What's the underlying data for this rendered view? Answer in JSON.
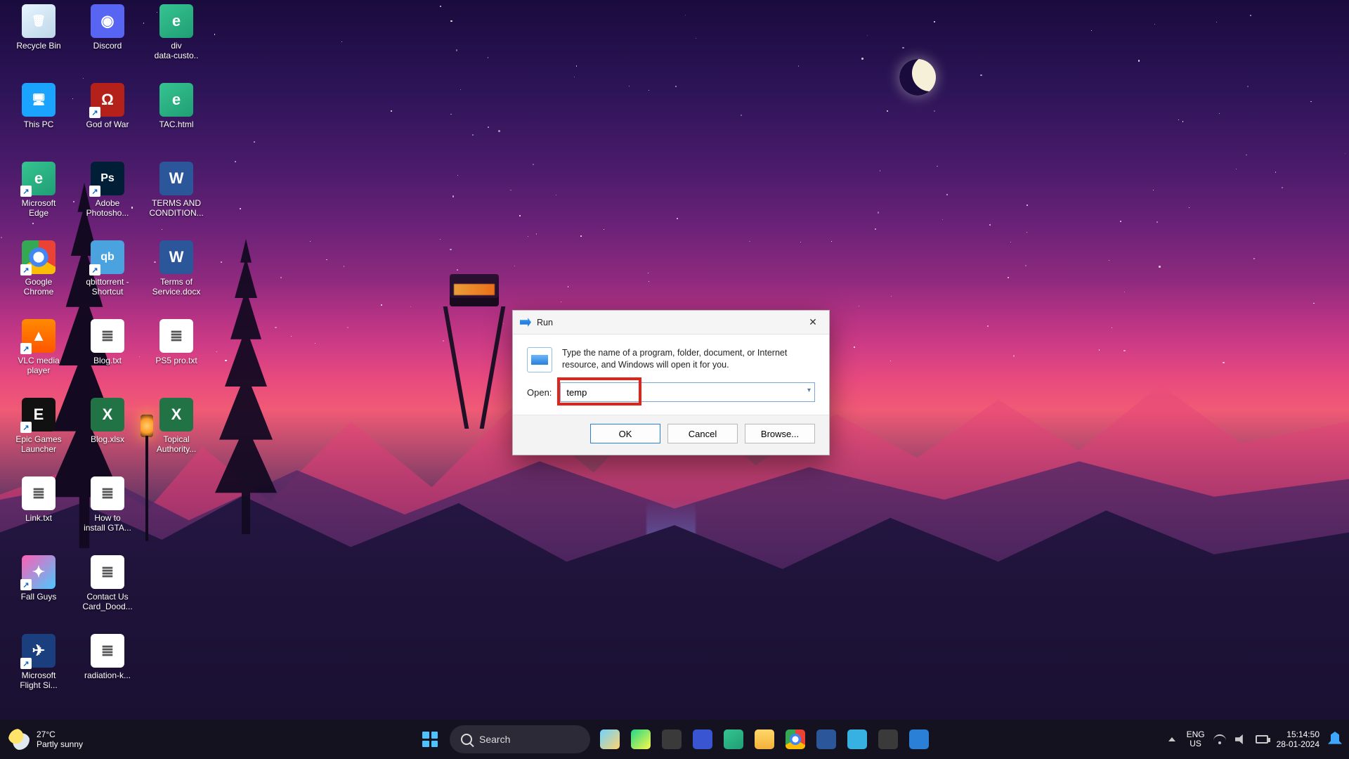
{
  "desktop_icons": [
    {
      "label": "Recycle Bin",
      "bg": "linear-gradient(145deg,#e7f4ff,#bcd7e8)",
      "glyph": "🗑"
    },
    {
      "label": "Discord",
      "bg": "#5865F2",
      "glyph": "◉"
    },
    {
      "label": "div\ndata-custo..",
      "bg": "linear-gradient(145deg,#36c491,#1f9e74)",
      "glyph": "e"
    },
    {
      "label": "This PC",
      "bg": "#1aa3ff",
      "glyph": "🖥"
    },
    {
      "label": "God of War",
      "bg": "#b3211a",
      "glyph": "Ω",
      "shortcut": true
    },
    {
      "label": "TAC.html",
      "bg": "linear-gradient(145deg,#36c491,#1f9e74)",
      "glyph": "e"
    },
    {
      "label": "Microsoft\nEdge",
      "bg": "linear-gradient(145deg,#36c491,#1f9e74)",
      "glyph": "e",
      "shortcut": true
    },
    {
      "label": "Adobe\nPhotosho...",
      "bg": "#001e36",
      "glyph": "Ps",
      "shortcut": true
    },
    {
      "label": "TERMS AND\nCONDITION...",
      "bg": "#2b579a",
      "glyph": "W"
    },
    {
      "label": "Google\nChrome",
      "bg": "radial-gradient(circle,#fff 0 22%,#4285f4 23% 40%,transparent 41%),conic-gradient(#ea4335 0 120deg,#fbbc05 120deg 240deg,#34a853 240deg 360deg)",
      "glyph": "",
      "shortcut": true
    },
    {
      "label": "qbittorrent -\nShortcut",
      "bg": "#4aa3df",
      "glyph": "qb",
      "shortcut": true
    },
    {
      "label": "Terms of\nService.docx",
      "bg": "#2b579a",
      "glyph": "W"
    },
    {
      "label": "VLC media\nplayer",
      "bg": "linear-gradient(180deg,#ff8a00,#ff5500)",
      "glyph": "▲",
      "shortcut": true
    },
    {
      "label": "Blog.txt",
      "bg": "#fff",
      "glyph": "≣",
      "fg": "#555"
    },
    {
      "label": "PS5 pro.txt",
      "bg": "#fff",
      "glyph": "≣",
      "fg": "#555"
    },
    {
      "label": "Epic Games\nLauncher",
      "bg": "#111",
      "glyph": "E",
      "shortcut": true
    },
    {
      "label": "Blog.xlsx",
      "bg": "#217346",
      "glyph": "X"
    },
    {
      "label": "Topical\nAuthority...",
      "bg": "#217346",
      "glyph": "X"
    },
    {
      "label": "Link.txt",
      "bg": "#fff",
      "glyph": "≣",
      "fg": "#555"
    },
    {
      "label": "How to\ninstall GTA...",
      "bg": "#fff",
      "glyph": "≣",
      "fg": "#555"
    },
    {
      "label": "Fall Guys",
      "bg": "linear-gradient(135deg,#ff5fb4,#4ac8ff)",
      "glyph": "✦",
      "shortcut": true
    },
    {
      "label": "Contact Us\nCard_Dood...",
      "bg": "#fff",
      "glyph": "≣",
      "fg": "#555"
    },
    {
      "label": "Microsoft\nFlight Si...",
      "bg": "#1b3e7e",
      "glyph": "✈",
      "shortcut": true
    },
    {
      "label": "radiation-k...",
      "bg": "#fff",
      "glyph": "≣",
      "fg": "#555"
    }
  ],
  "desktop_columns": [
    [
      0,
      3,
      6,
      9,
      12,
      15,
      18,
      20,
      22
    ],
    [
      1,
      4,
      7,
      10,
      13,
      16,
      19,
      21,
      23
    ],
    [
      2,
      5,
      8,
      11,
      14,
      17
    ]
  ],
  "run": {
    "title": "Run",
    "description": "Type the name of a program, folder, document, or Internet resource, and Windows will open it for you.",
    "open_label": "Open:",
    "value": "temp",
    "ok": "OK",
    "cancel": "Cancel",
    "browse": "Browse..."
  },
  "taskbar": {
    "weather_temp": "27°C",
    "weather_cond": "Partly sunny",
    "search_placeholder": "Search",
    "apps": [
      {
        "name": "widgets",
        "bg": "linear-gradient(135deg,#6fd3ff,#ffd36f)"
      },
      {
        "name": "pycharm",
        "bg": "linear-gradient(135deg,#21d789,#fcf84a)"
      },
      {
        "name": "task-view",
        "bg": "#3a3a3a"
      },
      {
        "name": "vscode-like",
        "bg": "#3955d1"
      },
      {
        "name": "edge",
        "bg": "linear-gradient(145deg,#36c491,#1f9e74)"
      },
      {
        "name": "file-explorer",
        "bg": "linear-gradient(180deg,#ffd869,#f3b13a)"
      },
      {
        "name": "chrome",
        "bg": "radial-gradient(circle,#fff 0 22%,#4285f4 23% 40%,transparent 41%),conic-gradient(#ea4335 0 120deg,#fbbc05 120deg 240deg,#34a853 240deg 360deg)"
      },
      {
        "name": "word",
        "bg": "#2b579a"
      },
      {
        "name": "notepad",
        "bg": "#36b1e1"
      },
      {
        "name": "settings",
        "bg": "#3a3a3a"
      },
      {
        "name": "run-app",
        "bg": "#2a7fd6"
      }
    ],
    "lang_top": "ENG",
    "lang_bot": "US",
    "time": "15:14:50",
    "date": "28-01-2024"
  }
}
